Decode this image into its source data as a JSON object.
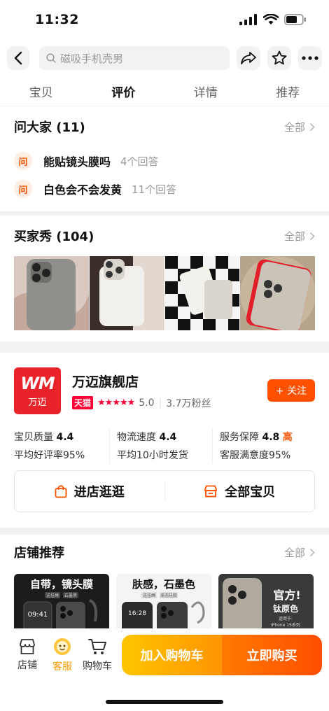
{
  "status_bar": {
    "time": "11:32"
  },
  "nav": {
    "search_placeholder": "磁吸手机壳男"
  },
  "tabs": [
    {
      "label": "宝贝"
    },
    {
      "label": "评价",
      "active": true
    },
    {
      "label": "详情"
    },
    {
      "label": "推荐"
    }
  ],
  "qa": {
    "title": "问大家 (11)",
    "more": "全部",
    "icon_label": "问",
    "items": [
      {
        "question": "能贴镜头膜吗",
        "answers": "4个回答"
      },
      {
        "question": "白色会不会发黄",
        "answers": "11个回答"
      }
    ]
  },
  "buyer_show": {
    "title": "买家秀 (104)",
    "more": "全部"
  },
  "store": {
    "logo_mark": "WM",
    "logo_name": "万迈",
    "name": "万迈旗舰店",
    "badge": "天猫",
    "stars": "★★★★★",
    "score": "5.0",
    "fans": "3.7万粉丝",
    "follow": "+ 关注",
    "ratings": [
      {
        "label": "宝贝质量",
        "value": "4.4",
        "sub": "平均好评率95%"
      },
      {
        "label": "物流速度",
        "value": "4.4",
        "sub": "平均10小时发货"
      },
      {
        "label": "服务保障",
        "value": "4.8",
        "level": "高",
        "sub": "客服满意度95%"
      }
    ],
    "actions": [
      {
        "label": "进店逛逛"
      },
      {
        "label": "全部宝贝"
      }
    ]
  },
  "recommend": {
    "title": "店铺推荐",
    "more": "全部",
    "items": [
      {
        "caption": "自带，镜头膜",
        "tag1": "送挂绳",
        "tag2": "石墨黑",
        "clock": "09:41"
      },
      {
        "caption": "肤感，石墨色",
        "tag1": "送挂绳",
        "tag2": "液态硅胶",
        "clock": "16:28"
      },
      {
        "caption": "官方!",
        "caption2": "钛原色",
        "small1": "适用于:",
        "small2": "iPhone 15系列"
      }
    ]
  },
  "bottom_bar": {
    "store_label": "店铺",
    "service_label": "客服",
    "cart_label": "购物车",
    "add_cart": "加入购物车",
    "buy_now": "立即购买"
  },
  "colors": {
    "accent": "#ff5000",
    "tmall": "#ff0036",
    "cart_btn": "#ffb000",
    "buy_btn": "#ff5a00"
  }
}
